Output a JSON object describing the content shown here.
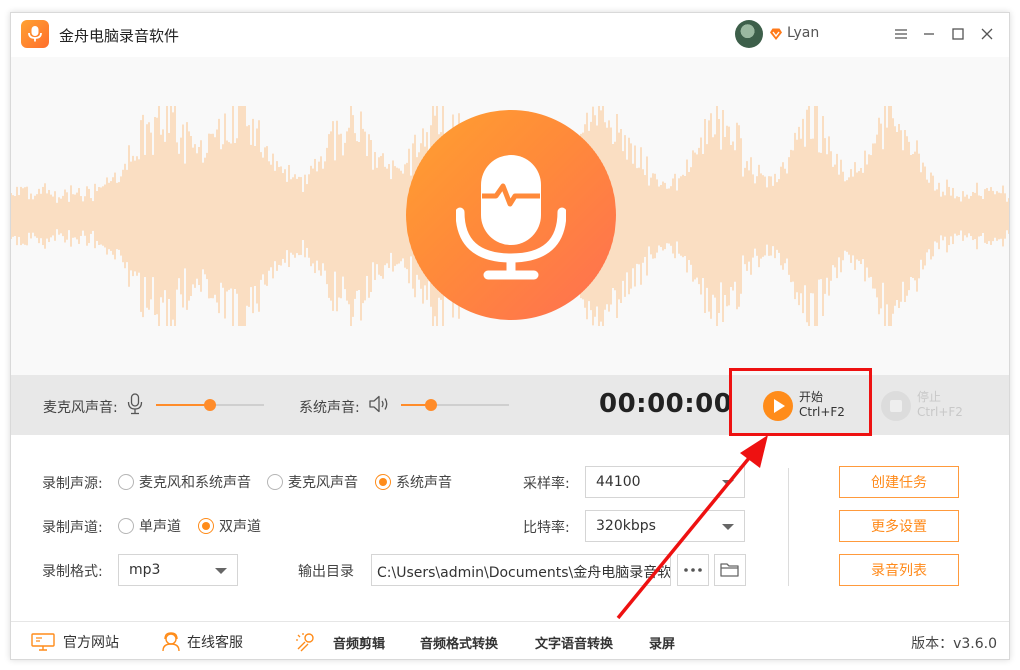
{
  "app": {
    "title": "金舟电脑录音软件",
    "username": "Lyan",
    "accent": "#ff8c1a"
  },
  "window_controls": [
    "menu-icon",
    "minimize-icon",
    "maximize-icon",
    "close-icon"
  ],
  "controls": {
    "mic_label": "麦克风声音:",
    "mic_volume": 0.5,
    "system_label": "系统声音:",
    "system_volume": 0.28,
    "timer": "00:00:00",
    "start": {
      "label": "开始",
      "shortcut": "Ctrl+F2"
    },
    "stop": {
      "label": "停止",
      "shortcut": "Ctrl+F2"
    }
  },
  "settings": {
    "source": {
      "label": "录制声源:",
      "options": [
        "麦克风和系统声音",
        "麦克风声音",
        "系统声音"
      ],
      "selected": 2
    },
    "channel": {
      "label": "录制声道:",
      "options": [
        "单声道",
        "双声道"
      ],
      "selected": 1
    },
    "format": {
      "label": "录制格式:",
      "value": "mp3"
    },
    "sample_rate": {
      "label": "采样率:",
      "value": "44100"
    },
    "bitrate": {
      "label": "比特率:",
      "value": "320kbps"
    },
    "output": {
      "label": "输出目录",
      "path": "C:\\Users\\admin\\Documents\\金舟电脑录音软"
    }
  },
  "actions": [
    "创建任务",
    "更多设置",
    "录音列表"
  ],
  "footer": {
    "official_site": "官方网站",
    "online_service": "在线客服",
    "tools": [
      "音频剪辑",
      "音频格式转换",
      "文字语音转换",
      "录屏"
    ],
    "version": "版本：v3.6.0"
  }
}
